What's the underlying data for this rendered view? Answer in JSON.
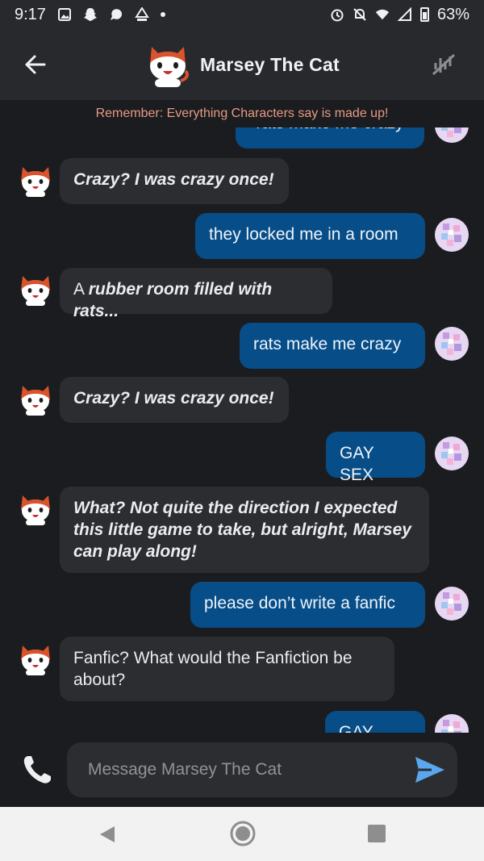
{
  "status_bar": {
    "time": "9:17",
    "battery": "63%"
  },
  "header": {
    "title": "Marsey The Cat"
  },
  "notice": "Remember: Everything Characters say is made up!",
  "messages": [
    {
      "sender": "user",
      "text": "rats make me crazy"
    },
    {
      "sender": "bot",
      "text": "Crazy? I was crazy once!"
    },
    {
      "sender": "user",
      "text": "they locked me in a room"
    },
    {
      "sender": "bot",
      "prefix": "A ",
      "text": "rubber room filled with rats..."
    },
    {
      "sender": "user",
      "text": "rats make me crazy"
    },
    {
      "sender": "bot",
      "text": "Crazy? I was crazy once!"
    },
    {
      "sender": "user",
      "text": "GAY SEX"
    },
    {
      "sender": "bot",
      "text": "What? Not quite the direction I expected this little game to take, but alright, Marsey can play along!"
    },
    {
      "sender": "user",
      "text": "please don’t write a fanfic"
    },
    {
      "sender": "bot",
      "text": "Fanfic? What would the Fanfiction be about?"
    },
    {
      "sender": "user",
      "text": "GAY SEX"
    }
  ],
  "composer": {
    "placeholder": "Message Marsey The Cat"
  },
  "colors": {
    "user_bubble": "#074d87",
    "bot_bubble": "#2c2d31",
    "background": "#1b1c1f",
    "notice_text": "#e79a83",
    "send_icon": "#5aa7ee"
  },
  "icons": [
    "back-arrow-icon",
    "mute-icon",
    "phone-icon",
    "send-icon",
    "cat-avatar",
    "user-avatar"
  ]
}
